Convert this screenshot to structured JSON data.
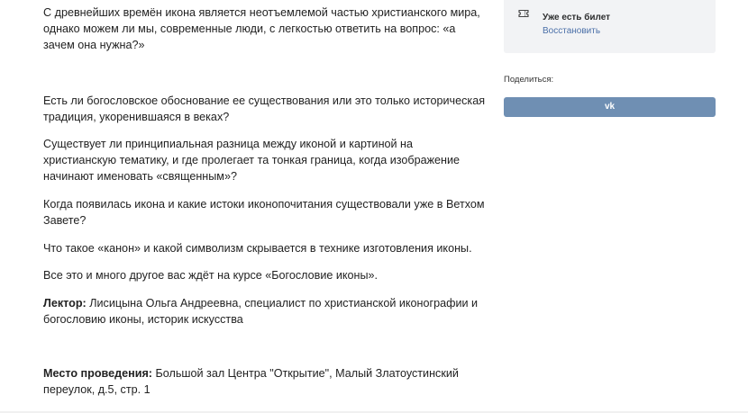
{
  "article": {
    "p1": "С древнейших времён икона является неотъемлемой частью христианского мира, однако можем ли мы, современные люди, с легкостью ответить на вопрос: «а зачем она нужна?»",
    "p2": "Есть ли богословское обоснование ее существования или это только историческая традиция, укоренившаяся в веках?",
    "p3": "Существует ли принципиальная разница между иконой и картиной на христианскую тематику, и где пролегает та тонкая граница, когда изображение начинают именовать «священным»?",
    "p4": "Когда появилась икона и какие истоки иконопочитания существовали уже в Ветхом Завете?",
    "p5": "Что такое «канон» и какой символизм скрывается в технике изготовления иконы.",
    "p6": "Все это и много другое вас ждёт на курсе «Богословие иконы».",
    "lecturer_label": "Лектор:",
    "lecturer_text": " Лисицына Ольга Андреевна, специалист по христианской иконографии и богословию иконы, историк искусства",
    "venue_label": "Место проведения:",
    "venue_text": " Большой зал Центра \"Открытие\", Малый Златоустинский переулок, д.5, стр. 1"
  },
  "sidebar": {
    "ticket_icon": "ticket-icon",
    "ticket_title": "Уже есть билет",
    "ticket_restore": "Восстановить",
    "share_label": "Поделиться:",
    "vk_label": "vk"
  },
  "colors": {
    "card_bg": "#f2f3f5",
    "link": "#4a6fa8",
    "vk_button": "#6f8fb3"
  }
}
